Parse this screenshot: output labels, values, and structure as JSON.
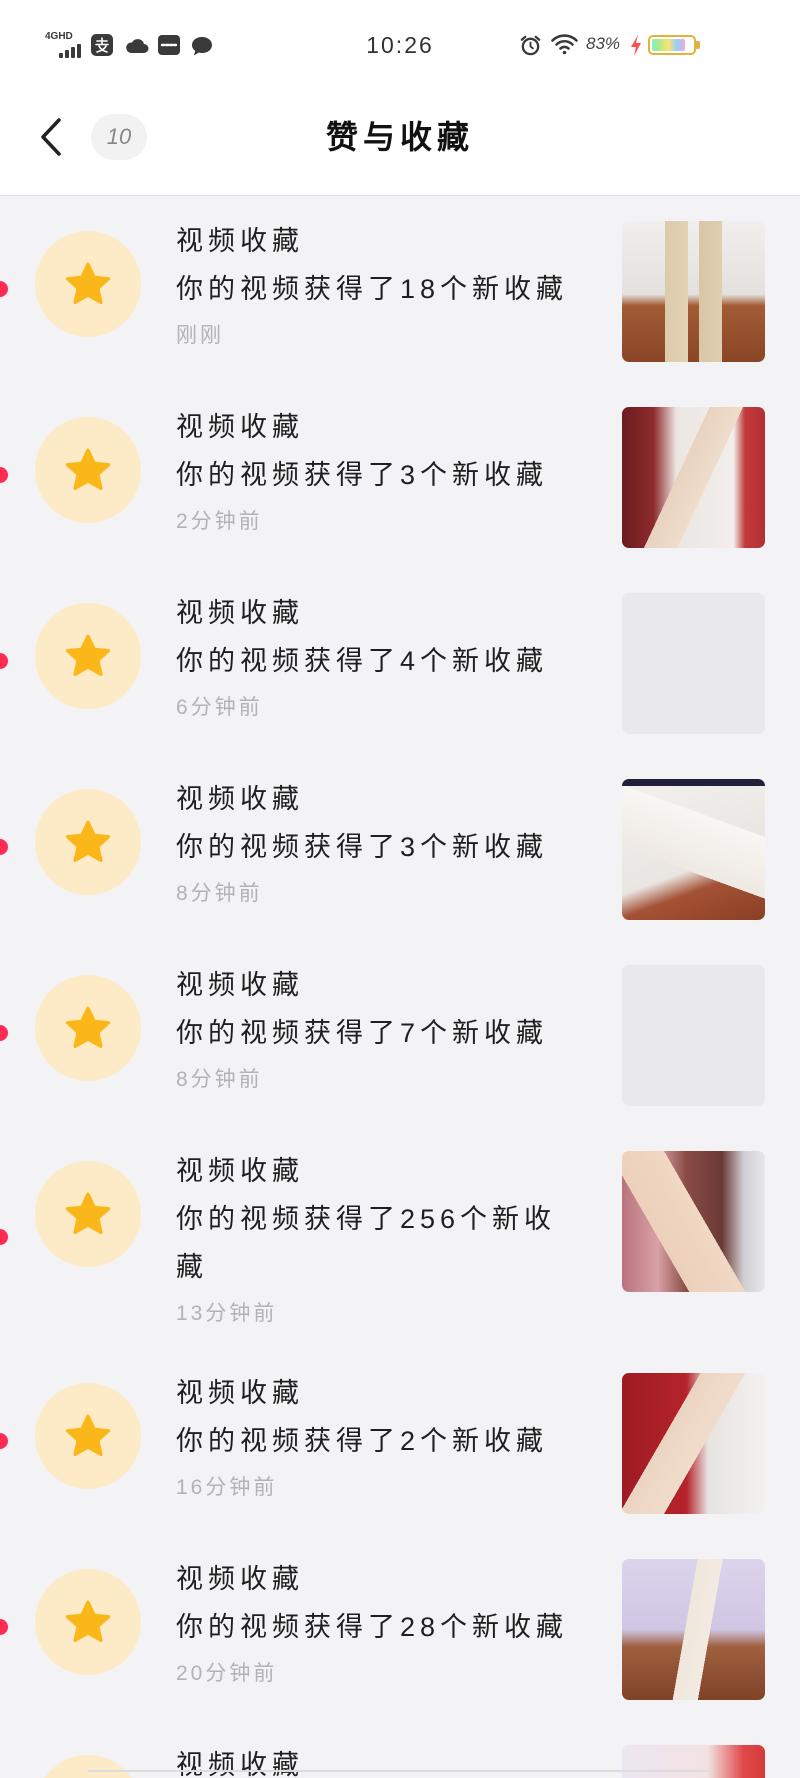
{
  "status_bar": {
    "network": "4GHD",
    "time": "10:26",
    "battery_text": "83%",
    "battery_level": 0.83,
    "left_icons": [
      "signal-icon",
      "alipay-icon",
      "cloud-icon",
      "youku-icon",
      "message-icon"
    ],
    "right_icons": [
      "alarm-icon",
      "wifi-icon",
      "charging-icon",
      "battery-icon"
    ]
  },
  "header": {
    "back_icon": "chevron-left-icon",
    "badge_count": "10",
    "title": "赞与收藏"
  },
  "notifications": [
    {
      "icon": "star-icon",
      "title": "视频收藏",
      "message": "你的视频获得了18个新收藏",
      "time": "刚刚"
    },
    {
      "icon": "star-icon",
      "title": "视频收藏",
      "message": "你的视频获得了3个新收藏",
      "time": "2分钟前"
    },
    {
      "icon": "star-icon",
      "title": "视频收藏",
      "message": "你的视频获得了4个新收藏",
      "time": "6分钟前"
    },
    {
      "icon": "star-icon",
      "title": "视频收藏",
      "message": "你的视频获得了3个新收藏",
      "time": "8分钟前"
    },
    {
      "icon": "star-icon",
      "title": "视频收藏",
      "message": "你的视频获得了7个新收藏",
      "time": "8分钟前"
    },
    {
      "icon": "star-icon",
      "title": "视频收藏",
      "message": "你的视频获得了256个新收藏",
      "time": "13分钟前"
    },
    {
      "icon": "star-icon",
      "title": "视频收藏",
      "message": "你的视频获得了2个新收藏",
      "time": "16分钟前"
    },
    {
      "icon": "star-icon",
      "title": "视频收藏",
      "message": "你的视频获得了28个新收藏",
      "time": "20分钟前"
    },
    {
      "icon": "star-icon",
      "title": "视频收藏"
    }
  ],
  "colors": {
    "star": "#fbb71a",
    "star_background": "#fcebc6",
    "unread_dot": "#fe2c55",
    "list_background": "#f3f3f5"
  }
}
